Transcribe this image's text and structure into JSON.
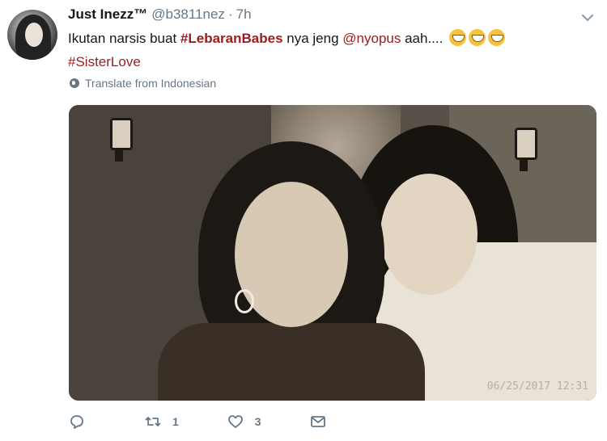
{
  "tweet": {
    "display_name": "Just Inezz™",
    "handle": "@b3811nez",
    "separator": "·",
    "time": "7h",
    "text_prefix": "Ikutan narsis buat ",
    "hashtag1": "#LebaranBabes",
    "text_middle": " nya jeng ",
    "mention": "@nyopus",
    "text_suffix": " aah....",
    "hashtag2": "#SisterLove",
    "emoji_count": 3,
    "emoji_icon": "grinning-face-icon",
    "translate_label": "Translate from Indonesian",
    "photo_timestamp": "06/25/2017 12:31"
  },
  "actions": {
    "reply_count": "",
    "retweet_count": "1",
    "like_count": "3"
  },
  "colors": {
    "link": "#9b1c1f",
    "muted": "#657786",
    "text": "#14171a"
  }
}
